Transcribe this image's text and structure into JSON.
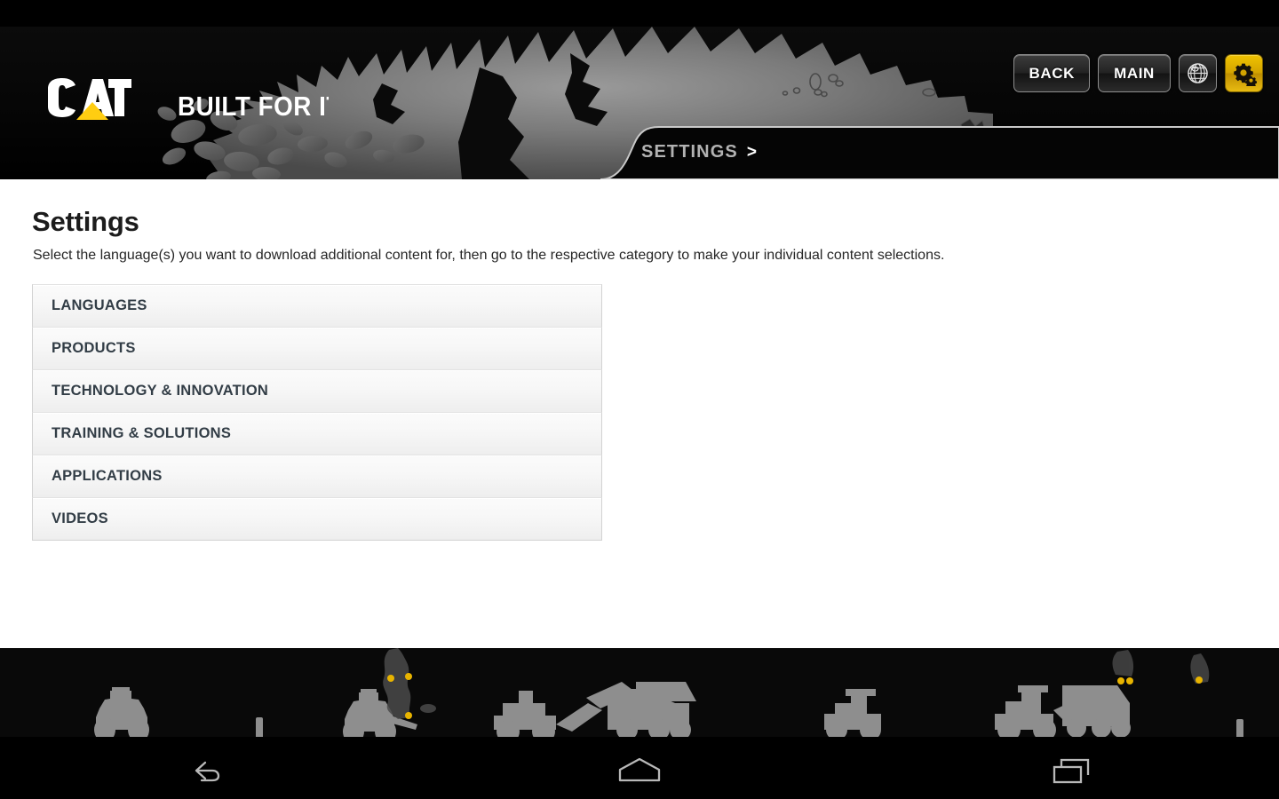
{
  "header": {
    "logo_text": "CAT",
    "logo_registered": "®",
    "tagline": "BUILT FOR IT.",
    "tagline_tm": "™",
    "buttons": [
      {
        "label": "BACK",
        "name": "back-button"
      },
      {
        "label": "MAIN",
        "name": "main-button"
      }
    ],
    "icons": [
      {
        "name": "globe-icon",
        "label": "Globe"
      },
      {
        "name": "gear-icon",
        "label": "Settings"
      }
    ],
    "breadcrumb": {
      "label": "SETTINGS",
      "arrow": ">"
    }
  },
  "main": {
    "title": "Settings",
    "description": "Select the language(s) you want to download additional content for, then go to the respective category to make your individual content selections.",
    "items": [
      {
        "label": "LANGUAGES"
      },
      {
        "label": "PRODUCTS"
      },
      {
        "label": "TECHNOLOGY & INNOVATION"
      },
      {
        "label": "TRAINING & SOLUTIONS"
      },
      {
        "label": "APPLICATIONS"
      },
      {
        "label": "VIDEOS"
      }
    ]
  },
  "navbar": {
    "items": [
      {
        "name": "android-back-icon",
        "label": "Back"
      },
      {
        "name": "android-home-icon",
        "label": "Home"
      },
      {
        "name": "android-recents-icon",
        "label": "Recent apps"
      }
    ]
  },
  "colors": {
    "cat_yellow": "#FFCD11",
    "gold_button": "#d4a400",
    "page_bg": "#ffffff",
    "header_bg": "#000000",
    "list_text": "#323d46",
    "breadcrumb_text": "#b2b2b2"
  }
}
